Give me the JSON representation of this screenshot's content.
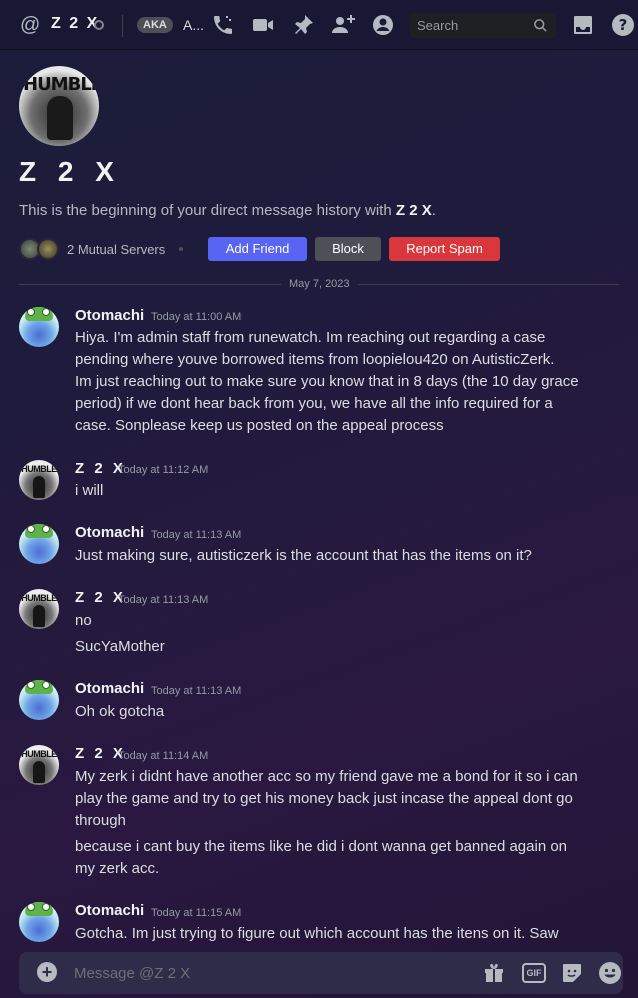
{
  "topbar": {
    "dm_name": "Z 2 X",
    "aka_badge": "AKA",
    "aka_name": "A...",
    "search_placeholder": "Search",
    "icons": [
      "at-icon",
      "status-icon",
      "voice-call-icon",
      "video-call-icon",
      "pin-icon",
      "add-friend-icon",
      "user-profile-icon",
      "search-icon",
      "inbox-icon",
      "help-icon"
    ]
  },
  "profile": {
    "display_name": "Z 2 X",
    "intro_prefix": "This is the beginning of your direct message history with ",
    "intro_name": "Z 2 X",
    "intro_suffix": ".",
    "mutual_servers": "2 Mutual Servers",
    "avatar_text": "HUMBLE",
    "buttons": {
      "add_friend": "Add Friend",
      "block": "Block",
      "report_spam": "Report Spam"
    }
  },
  "date_divider": "May 7, 2023",
  "messages": [
    {
      "author": "Otomachi",
      "timestamp": "Today at 11:00 AM",
      "lines": [
        "Hiya. I'm admin staff from runewatch. Im reaching out regarding a case",
        "pending where youve borrowed items from loopielou420 on AutisticZerk.",
        "Im just reaching out to make sure you know that in 8 days (the 10 day grace",
        "period) if we dont hear back from you, we have all the info required for a",
        "case. Sonplease keep us posted on the appeal process"
      ]
    },
    {
      "author": "Z 2 X",
      "timestamp": "Today at 11:12 AM",
      "lines": [
        "i will"
      ]
    },
    {
      "author": "Otomachi",
      "timestamp": "Today at 11:13 AM",
      "lines": [
        "Just making sure, autisticzerk is the account that has the items on it?"
      ]
    },
    {
      "author": "Z 2 X",
      "timestamp": "Today at 11:13 AM",
      "lines": [
        "no",
        "SucYaMother"
      ]
    },
    {
      "author": "Otomachi",
      "timestamp": "Today at 11:13 AM",
      "lines": [
        "Oh ok gotcha"
      ]
    },
    {
      "author": "Z 2 X",
      "timestamp": "Today at 11:14 AM",
      "lines": [
        "My zerk i didnt have another acc so my friend gave me a bond for it so i can",
        "play the game and try to get his money back just incase the appeal dont go",
        "through",
        "because i cant buy the items like he did i dont wanna get banned again on",
        "my zerk acc."
      ]
    },
    {
      "author": "Otomachi",
      "timestamp": "Today at 11:15 AM",
      "lines": [
        "Gotcha. Im just trying to figure out which account has the itens on it. Saw"
      ]
    }
  ],
  "composer": {
    "placeholder": "Message @Z 2 X",
    "gif_label": "GIF"
  },
  "colors": {
    "blurple": "#5865f2",
    "danger": "#da373c",
    "secondary": "#4e5058"
  }
}
